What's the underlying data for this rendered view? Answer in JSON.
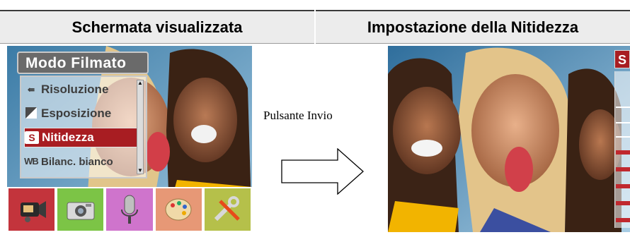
{
  "headers": {
    "left": "Schermata visualizzata",
    "right": "Impostazione della Nitidezza"
  },
  "left_screen": {
    "menu_title": "Modo Filmato",
    "menu_items": [
      {
        "icon": "resolution-icon",
        "label": "Risoluzione",
        "selected": false
      },
      {
        "icon": "exposure-icon",
        "label": "Esposizione",
        "selected": false
      },
      {
        "icon_text": "S",
        "icon": "sharpness-icon",
        "label": "Nitidezza",
        "selected": true
      },
      {
        "icon_text": "WB",
        "icon": "white-balance-icon",
        "label": "Bilanc. bianco",
        "selected": false
      }
    ],
    "mode_tabs": [
      {
        "icon": "video-camera-icon",
        "color": "#c3343c"
      },
      {
        "icon": "camera-icon",
        "color": "#7cc446"
      },
      {
        "icon": "microphone-icon",
        "color": "#cf74cc"
      },
      {
        "icon": "palette-icon",
        "color": "#e79876"
      },
      {
        "icon": "tools-icon",
        "color": "#b5c04a"
      }
    ]
  },
  "arrow": {
    "label": "Pulsante Invio",
    "icon": "right-arrow-icon"
  },
  "right_screen": {
    "badge": "S"
  },
  "colors": {
    "selected_item": "#a81d22",
    "header_bg": "#ececec"
  }
}
